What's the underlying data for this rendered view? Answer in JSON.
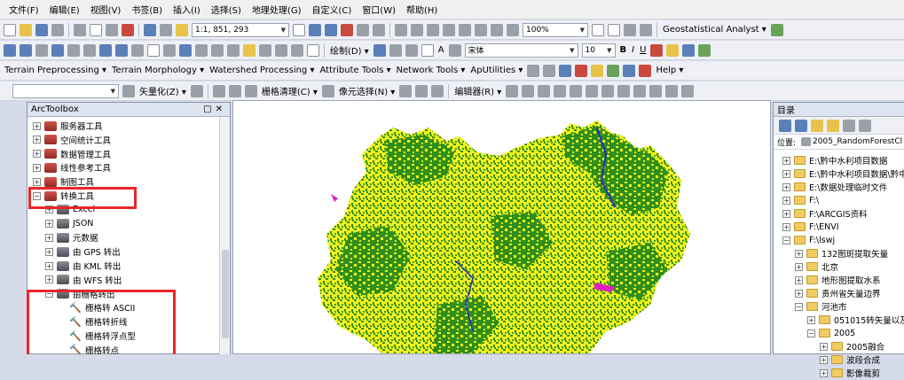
{
  "menu": [
    "文件(F)",
    "编辑(E)",
    "视图(V)",
    "书签(B)",
    "插入(I)",
    "选择(S)",
    "地理处理(G)",
    "自定义(C)",
    "窗口(W)",
    "帮助(H)"
  ],
  "toolbar1": {
    "scale": "1:1, 851, 293",
    "zoom": "100%",
    "geostat": "Geostatistical Analyst ▾"
  },
  "toolbar2": {
    "draw": "绘制(D) ▾",
    "font": "宋体",
    "size": "10",
    "bold": "B",
    "italic": "I",
    "underline": "U",
    "textA": "A"
  },
  "toolbar3": [
    "Terrain Preprocessing ▾",
    "Terrain Morphology ▾",
    "Watershed Processing ▾",
    "Attribute Tools ▾",
    "Network Tools ▾",
    "ApUtilities ▾",
    "Help ▾"
  ],
  "toolbar4": {
    "vectorize": "矢量化(Z) ▾",
    "clean": "栅格清理(C) ▾",
    "cellselect": "像元选择(N) ▾",
    "editor": "编辑器(R) ▾"
  },
  "arctoolbox": {
    "title": "ArcToolbox",
    "items": [
      {
        "label": "服务器工具",
        "level": 0,
        "exp": "+",
        "kind": "red"
      },
      {
        "label": "空间统计工具",
        "level": 0,
        "exp": "+",
        "kind": "red"
      },
      {
        "label": "数据管理工具",
        "level": 0,
        "exp": "+",
        "kind": "red"
      },
      {
        "label": "线性参考工具",
        "level": 0,
        "exp": "+",
        "kind": "red"
      },
      {
        "label": "制图工具",
        "level": 0,
        "exp": "+",
        "kind": "red"
      },
      {
        "label": "转换工具",
        "level": 0,
        "exp": "−",
        "kind": "red"
      },
      {
        "label": "Excel",
        "level": 1,
        "exp": "+",
        "kind": "gray"
      },
      {
        "label": "JSON",
        "level": 1,
        "exp": "+",
        "kind": "gray"
      },
      {
        "label": "元数据",
        "level": 1,
        "exp": "+",
        "kind": "gray"
      },
      {
        "label": "由 GPS 转出",
        "level": 1,
        "exp": "+",
        "kind": "gray"
      },
      {
        "label": "由 KML 转出",
        "level": 1,
        "exp": "+",
        "kind": "gray"
      },
      {
        "label": "由 WFS 转出",
        "level": 1,
        "exp": "+",
        "kind": "gray"
      },
      {
        "label": "由栅格转出",
        "level": 1,
        "exp": "−",
        "kind": "gray"
      },
      {
        "label": "栅格转 ASCII",
        "level": 2,
        "exp": "",
        "kind": "hammer"
      },
      {
        "label": "栅格转折线",
        "level": 2,
        "exp": "",
        "kind": "hammer"
      },
      {
        "label": "栅格转浮点型",
        "level": 2,
        "exp": "",
        "kind": "hammer"
      },
      {
        "label": "栅格转点",
        "level": 2,
        "exp": "",
        "kind": "hammer"
      }
    ]
  },
  "catalog": {
    "title": "目录",
    "location_label": "位置:",
    "location_value": "2005_RandomForestCl",
    "items": [
      {
        "label": "E:\\黔中水利项目数据",
        "level": 0,
        "exp": "+"
      },
      {
        "label": "E:\\黔中水利项目数据\\黔中",
        "level": 0,
        "exp": "+"
      },
      {
        "label": "E:\\数据处理临时文件",
        "level": 0,
        "exp": "+"
      },
      {
        "label": "F:\\",
        "level": 0,
        "exp": "+"
      },
      {
        "label": "F:\\ARCGIS资料",
        "level": 0,
        "exp": "+"
      },
      {
        "label": "F:\\ENVI",
        "level": 0,
        "exp": "+"
      },
      {
        "label": "F:\\lswj",
        "level": 0,
        "exp": "−"
      },
      {
        "label": "132图斑提取矢量",
        "level": 1,
        "exp": "+"
      },
      {
        "label": "北京",
        "level": 1,
        "exp": "+"
      },
      {
        "label": "地形图提取水系",
        "level": 1,
        "exp": "+"
      },
      {
        "label": "贵州省矢量边界",
        "level": 1,
        "exp": "+"
      },
      {
        "label": "河池市",
        "level": 1,
        "exp": "−"
      },
      {
        "label": "051015转矢量以及",
        "level": 2,
        "exp": "+"
      },
      {
        "label": "2005",
        "level": 2,
        "exp": "−"
      },
      {
        "label": "2005融合",
        "level": 3,
        "exp": "+"
      },
      {
        "label": "波段合成",
        "level": 3,
        "exp": "+"
      },
      {
        "label": "影像裁剪",
        "level": 3,
        "exp": "+"
      }
    ]
  },
  "colors": {
    "accent_red": "#e8262b",
    "map_green": "#2f8f1a",
    "map_yellow": "#f2f21c",
    "map_bg": "#ffffff"
  }
}
